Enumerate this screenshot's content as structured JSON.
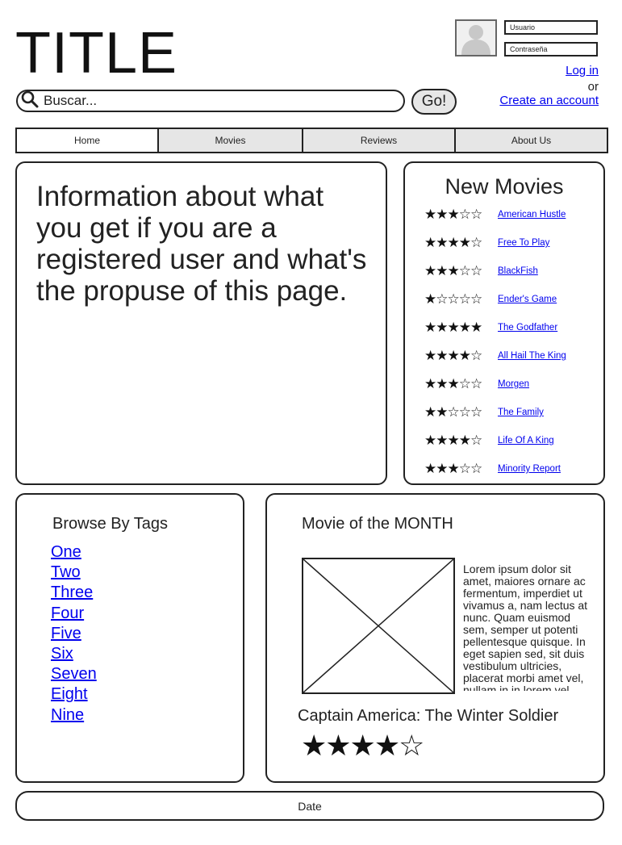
{
  "header": {
    "title": "TITLE"
  },
  "search": {
    "placeholder": "Buscar...",
    "button_label": "Go!",
    "icon": "search-icon"
  },
  "login": {
    "avatar_icon": "user-avatar-icon",
    "username_placeholder": "Usuario",
    "password_placeholder": "Contraseña",
    "login_link": "Log in",
    "or_text": "or",
    "create_account_link": "Create an account"
  },
  "nav": {
    "tabs": [
      {
        "label": "Home",
        "active": true
      },
      {
        "label": "Movies",
        "active": false
      },
      {
        "label": "Reviews",
        "active": false
      },
      {
        "label": "About Us",
        "active": false
      }
    ]
  },
  "info": {
    "text": "Information about what you get if you are a registered user and what's the propuse of this page."
  },
  "new_movies": {
    "title": "New Movies",
    "items": [
      {
        "title": "American Hustle",
        "rating": 3,
        "max": 5
      },
      {
        "title": "Free To Play",
        "rating": 4,
        "max": 5
      },
      {
        "title": "BlackFish",
        "rating": 3,
        "max": 5
      },
      {
        "title": "Ender's Game",
        "rating": 1,
        "max": 5
      },
      {
        "title": "The Godfather",
        "rating": 5,
        "max": 5
      },
      {
        "title": "All Hail The King",
        "rating": 4,
        "max": 5
      },
      {
        "title": "Morgen",
        "rating": 3,
        "max": 5
      },
      {
        "title": "The Family",
        "rating": 2,
        "max": 5
      },
      {
        "title": "Life Of A King",
        "rating": 4,
        "max": 5
      },
      {
        "title": "Minority Report",
        "rating": 3,
        "max": 5
      }
    ]
  },
  "tags": {
    "title": "Browse By Tags",
    "items": [
      "One",
      "Two",
      "Three",
      "Four",
      "Five",
      "Six",
      "Seven",
      "Eight",
      "Nine"
    ]
  },
  "movie_of_month": {
    "title": "Movie of the MONTH",
    "image_icon": "image-placeholder-icon",
    "description": "Lorem ipsum dolor sit amet, maiores ornare ac fermentum, imperdiet ut vivamus a, nam lectus at nunc. Quam euismod sem, semper ut potenti pellentesque quisque. In eget sapien sed, sit duis vestibulum ultricies, placerat morbi amet vel, nullam in in lorem vel.",
    "movie_title": "Captain America: The Winter Soldier",
    "rating": 4,
    "max": 5
  },
  "footer": {
    "text": "Date"
  }
}
